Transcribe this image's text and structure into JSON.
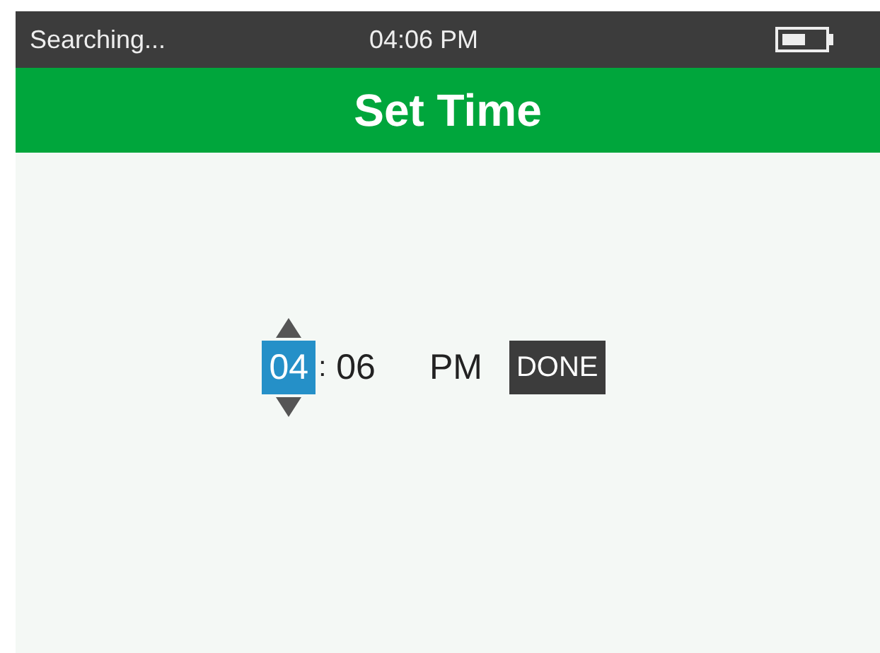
{
  "status_bar": {
    "status": "Searching...",
    "time": "04:06 PM"
  },
  "header": {
    "title": "Set Time"
  },
  "time_picker": {
    "fields": [
      {
        "value": "04",
        "selected": true
      },
      {
        "value": "06",
        "selected": false
      },
      {
        "value": "PM",
        "selected": false
      }
    ],
    "separator": ":",
    "done_button": "DONE"
  }
}
